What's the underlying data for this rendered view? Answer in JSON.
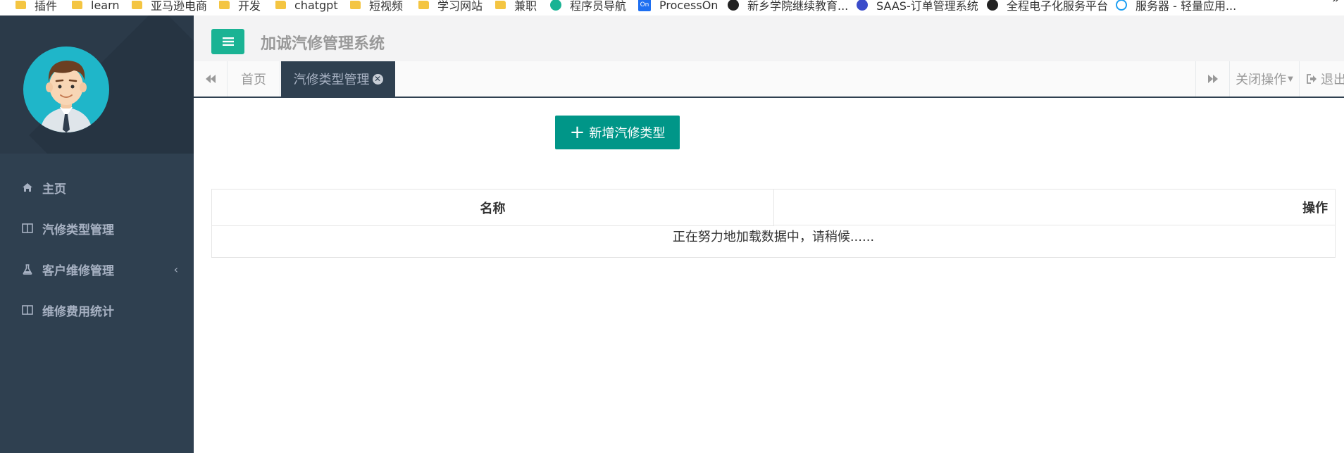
{
  "bookmarks": {
    "items": [
      {
        "label": "插件",
        "icon": "folder-icon"
      },
      {
        "label": "learn",
        "icon": "folder-icon"
      },
      {
        "label": "亚马逊电商",
        "icon": "folder-icon"
      },
      {
        "label": "开发",
        "icon": "folder-icon"
      },
      {
        "label": "chatgpt",
        "icon": "folder-icon"
      },
      {
        "label": "短视频",
        "icon": "folder-icon"
      },
      {
        "label": "学习网站",
        "icon": "folder-icon"
      },
      {
        "label": "兼职",
        "icon": "folder-icon"
      },
      {
        "label": "程序员导航",
        "icon": "site-icon"
      },
      {
        "label": "ProcessOn",
        "icon": "processon-icon"
      },
      {
        "label": "新乡学院继续教育...",
        "icon": "site-icon"
      },
      {
        "label": "SAAS-订单管理系统",
        "icon": "site-icon"
      },
      {
        "label": "全程电子化服务平台",
        "icon": "site-icon"
      },
      {
        "label": "服务器 - 轻量应用...",
        "icon": "cloud-icon"
      }
    ],
    "more": "»"
  },
  "sidebar": {
    "items": [
      {
        "label": "主页",
        "icon": "home-icon"
      },
      {
        "label": "汽修类型管理",
        "icon": "columns-icon"
      },
      {
        "label": "客户维修管理",
        "icon": "flask-icon",
        "arrow": "‹"
      },
      {
        "label": "维修费用统计",
        "icon": "columns-icon"
      }
    ]
  },
  "header": {
    "title": "加诚汽修管理系统"
  },
  "tabs": {
    "home": "首页",
    "active": "汽修类型管理",
    "close_ops": "关闭操作",
    "logout": "退出"
  },
  "content": {
    "add_button": "新增汽修类型",
    "table": {
      "columns": [
        "名称",
        "操作"
      ],
      "loading": "正在努力地加载数据中，请稍候......"
    }
  },
  "colors": {
    "sidebar": "#2f4050",
    "accent": "#1ab394",
    "add_button": "#009688"
  }
}
